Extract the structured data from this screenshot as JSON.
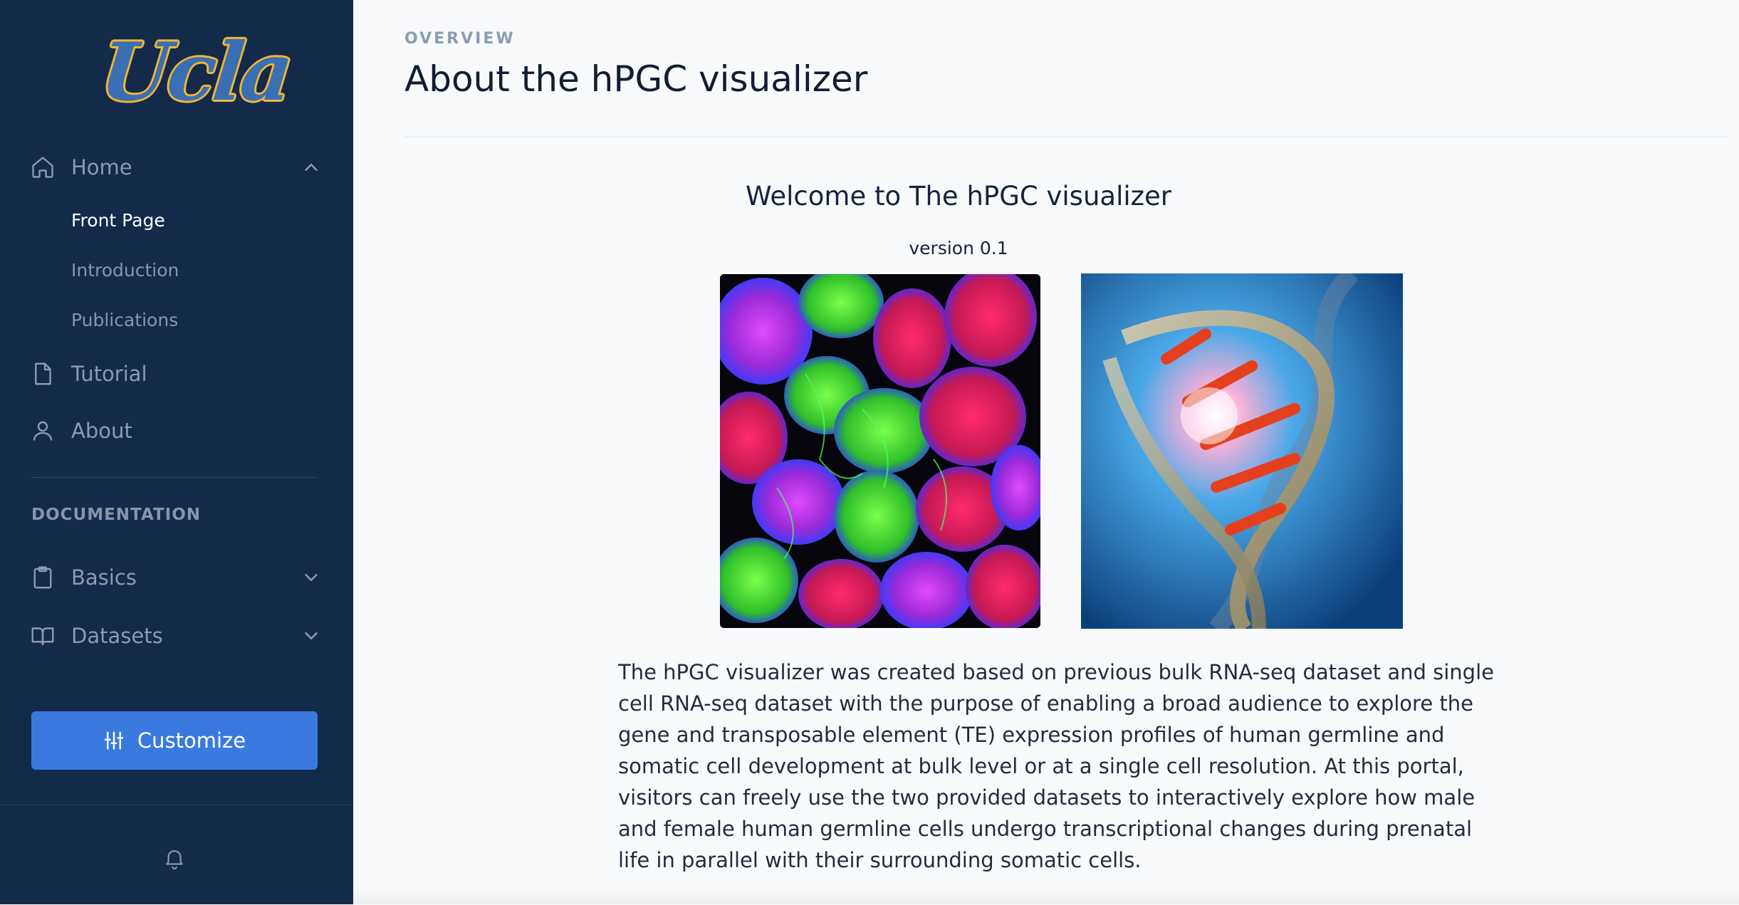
{
  "sidebar": {
    "logo_text": "Ucla",
    "nav": {
      "home": {
        "label": "Home",
        "icon": "home-icon"
      },
      "front_page": "Front Page",
      "introduction": "Introduction",
      "publications": "Publications",
      "tutorial": {
        "label": "Tutorial",
        "icon": "file-icon"
      },
      "about": {
        "label": "About",
        "icon": "user-icon"
      }
    },
    "documentation": {
      "section_title": "DOCUMENTATION",
      "basics": {
        "label": "Basics",
        "icon": "clipboard-icon"
      },
      "datasets": {
        "label": "Datasets",
        "icon": "book-icon"
      }
    },
    "customize_label": "Customize",
    "bell_icon": "bell-icon"
  },
  "header": {
    "overline": "OVERVIEW",
    "title": "About the hPGC visualizer"
  },
  "content": {
    "welcome_heading": "Welcome to The hPGC visualizer",
    "version": "version 0.1",
    "paragraph": "The hPGC visualizer was created based on previous bulk RNA-seq dataset and single cell RNA-seq dataset with the purpose of enabling a broad audience to explore the gene and transposable element (TE) expression profiles of human germline and somatic cell development at bulk level or at a single cell resolution. At this portal, visitors can freely use the two provided datasets to interactively explore how male and female human germline cells undergo transcriptional changes during prenatal life in parallel with their surrounding somatic cells."
  },
  "colors": {
    "sidebar_bg": "#132a4b",
    "accent": "#3a7ae0",
    "logo_blue": "#3a6fb3",
    "logo_gold": "#f2b632"
  }
}
